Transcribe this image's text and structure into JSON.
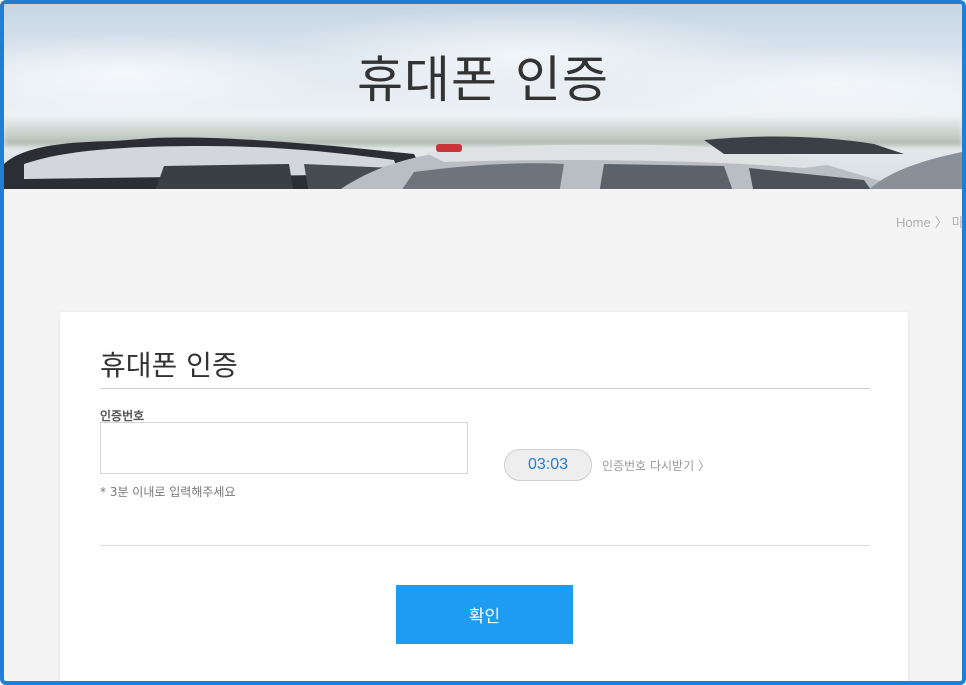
{
  "hero": {
    "title": "휴대폰 인증"
  },
  "breadcrumb": {
    "home": "Home",
    "separator": "〉",
    "next": "마"
  },
  "card": {
    "title": "휴대폰 인증",
    "field_label": "인증번호",
    "input_value": "",
    "timer": "03:03",
    "resend_label": "인증번호 다시받기 〉",
    "hint": "* 3분 이내로 입력해주세요",
    "confirm_label": "확인"
  },
  "colors": {
    "frame": "#1f7fd6",
    "accent": "#1e9cf2",
    "timer_text": "#1f7fd6"
  }
}
